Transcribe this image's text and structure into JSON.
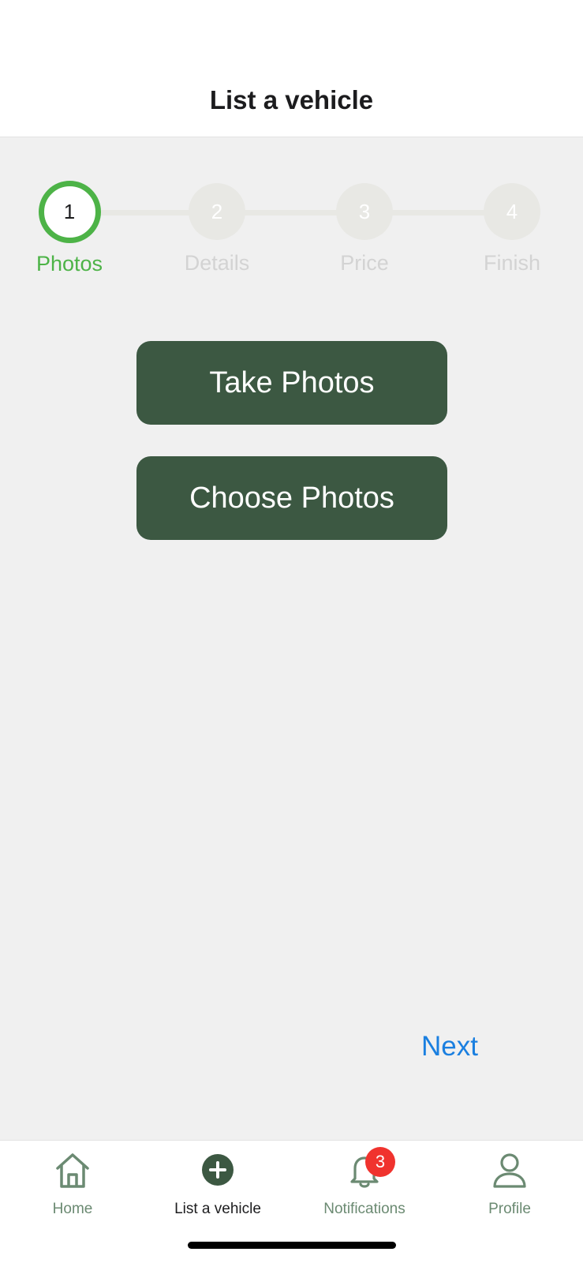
{
  "header": {
    "title": "List a vehicle"
  },
  "stepper": {
    "current_step": 1,
    "steps": [
      {
        "number": "1",
        "label": "Photos",
        "active": true
      },
      {
        "number": "2",
        "label": "Details",
        "active": false
      },
      {
        "number": "3",
        "label": "Price",
        "active": false
      },
      {
        "number": "4",
        "label": "Finish",
        "active": false
      }
    ],
    "colors": {
      "active": "#4db347",
      "inactive": "#e8e8e4",
      "inactive_text": "#d3d3d3"
    }
  },
  "actions": {
    "take_photos": "Take Photos",
    "choose_photos": "Choose Photos",
    "button_color": "#3c5842"
  },
  "next_label": "Next",
  "next_color": "#1a7fe0",
  "tabbar": {
    "items": [
      {
        "label": "Home",
        "icon": "home-icon",
        "current": false
      },
      {
        "label": "List a vehicle",
        "icon": "plus-circle-icon",
        "current": true
      },
      {
        "label": "Notifications",
        "icon": "bell-icon",
        "current": false,
        "badge": "3"
      },
      {
        "label": "Profile",
        "icon": "person-icon",
        "current": false
      }
    ]
  }
}
